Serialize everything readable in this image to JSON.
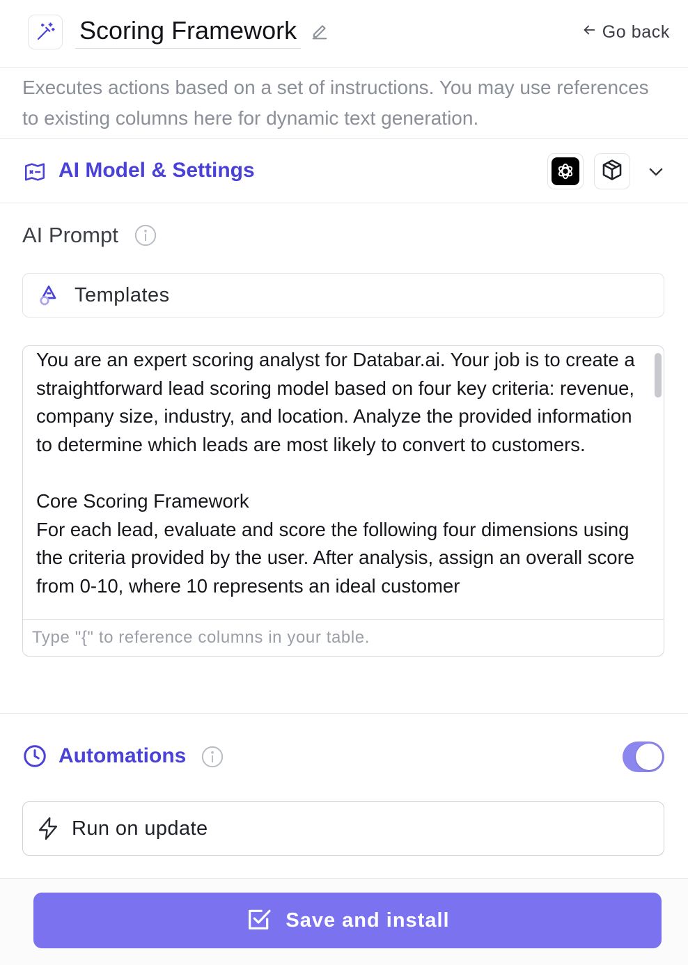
{
  "header": {
    "app_icon": "magic-wand-icon",
    "title": "Scoring Framework",
    "edit_icon": "pencil-icon",
    "go_back_label": "Go back",
    "go_back_icon": "arrow-left-icon"
  },
  "description": "Executes actions based on a set of instructions. You may use references to existing columns here for dynamic text generation.",
  "model_settings": {
    "icon": "map-icon",
    "title": "AI Model & Settings",
    "providers": [
      {
        "name": "openai-icon"
      },
      {
        "name": "cube-icon"
      }
    ],
    "expand_icon": "chevron-down-icon"
  },
  "prompt": {
    "label": "AI Prompt",
    "info_icon": "info-icon",
    "templates_label": "Templates",
    "templates_icon": "shapes-icon",
    "text": "You are an expert scoring analyst for Databar.ai. Your job is to create a straightforward lead scoring model based on four key criteria: revenue, company size, industry, and location. Analyze the provided information to determine which leads are most likely to convert to customers.\n\nCore Scoring Framework\nFor each lead, evaluate and score the following four dimensions using the criteria provided by the user. After analysis, assign an overall score from 0-10, where 10 represents an ideal customer",
    "input_placeholder": "Type \"{\" to reference columns in your table."
  },
  "automations": {
    "icon": "clock-icon",
    "title": "Automations",
    "info_icon": "info-icon",
    "enabled": true,
    "run_on_update_label": "Run on update",
    "run_on_update_icon": "lightning-icon"
  },
  "footer": {
    "save_label": "Save and install",
    "save_icon": "checkbox-edit-icon"
  },
  "colors": {
    "accent": "#4a42d6",
    "button": "#7a72ee",
    "toggle": "#8c86ef",
    "muted_text": "#8a8f98"
  }
}
